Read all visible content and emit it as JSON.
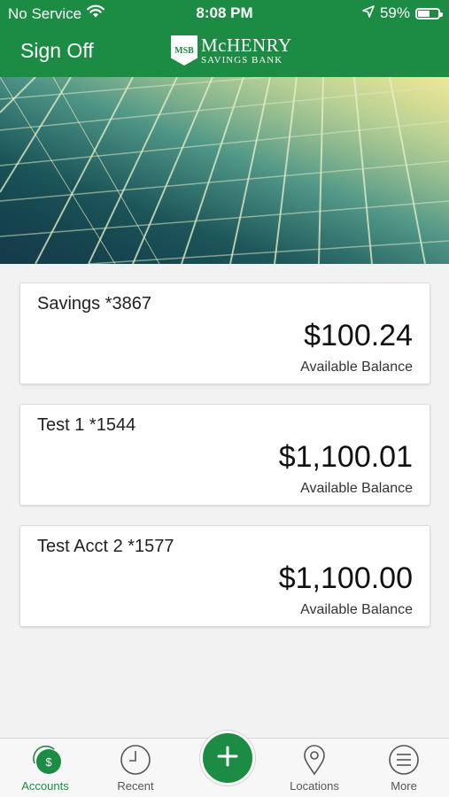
{
  "status_bar": {
    "carrier": "No Service",
    "time": "8:08 PM",
    "battery": "59%",
    "battery_level": 0.59
  },
  "header": {
    "sign_off_label": "Sign Off",
    "logo": {
      "badge": "MSB",
      "name": "McHENRY",
      "subtitle": "SAVINGS BANK"
    }
  },
  "accounts": [
    {
      "name": "Savings *3867",
      "balance": "$100.24",
      "balance_label": "Available Balance"
    },
    {
      "name": "Test 1 *1544",
      "balance": "$1,100.01",
      "balance_label": "Available Balance"
    },
    {
      "name": "Test Acct 2 *1577",
      "balance": "$1,100.00",
      "balance_label": "Available Balance"
    }
  ],
  "tabbar": {
    "accounts": "Accounts",
    "recent": "Recent",
    "locations": "Locations",
    "more": "More",
    "accounts_icon_symbol": "$"
  },
  "colors": {
    "brand_green": "#1c8c45",
    "background": "#f2f2f2"
  },
  "icons": [
    "wifi-icon",
    "location-arrow-icon",
    "battery-icon",
    "dollar-coin-icon",
    "clock-icon",
    "plus-icon",
    "map-pin-icon",
    "menu-icon"
  ]
}
